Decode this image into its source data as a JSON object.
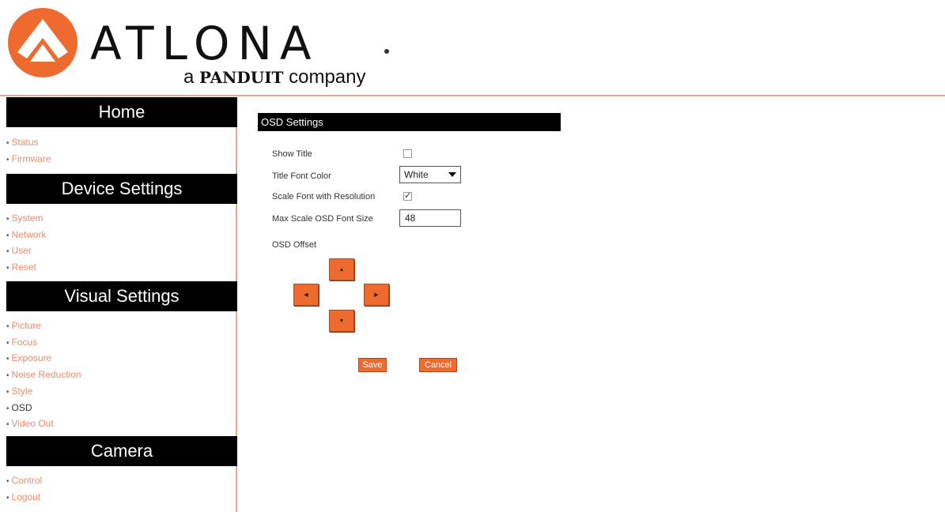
{
  "brand": {
    "name": "ATLONA",
    "tagline_a": "a",
    "tagline_panduit": "PANDUIT",
    "tagline_company": "company",
    "accent_color": "#ee6a2e"
  },
  "sidebar": {
    "sections": [
      {
        "title": "Home",
        "items": [
          "Status",
          "Firmware"
        ]
      },
      {
        "title": "Device Settings",
        "items": [
          "System",
          "Network",
          "User",
          "Reset"
        ]
      },
      {
        "title": "Visual Settings",
        "items": [
          "Picture",
          "Focus",
          "Exposure",
          "Noise Reduction",
          "Style",
          "OSD",
          "Video Out"
        ]
      },
      {
        "title": "Camera",
        "items": [
          "Control",
          "Logout"
        ]
      }
    ],
    "active_item": "OSD"
  },
  "osd": {
    "title": "OSD Settings",
    "show_title_label": "Show Title",
    "show_title_checked": false,
    "font_color_label": "Title Font Color",
    "font_color_value": "White",
    "scale_font_label": "Scale Font with Resolution",
    "scale_font_checked": true,
    "max_font_label": "Max Scale OSD Font Size",
    "max_font_value": "48",
    "offset_label": "OSD Offset",
    "up_arrow": "▲",
    "left_arrow": "◀",
    "right_arrow": "▶",
    "down_arrow": "▼",
    "save_label": "Save",
    "cancel_label": "Cancel"
  }
}
